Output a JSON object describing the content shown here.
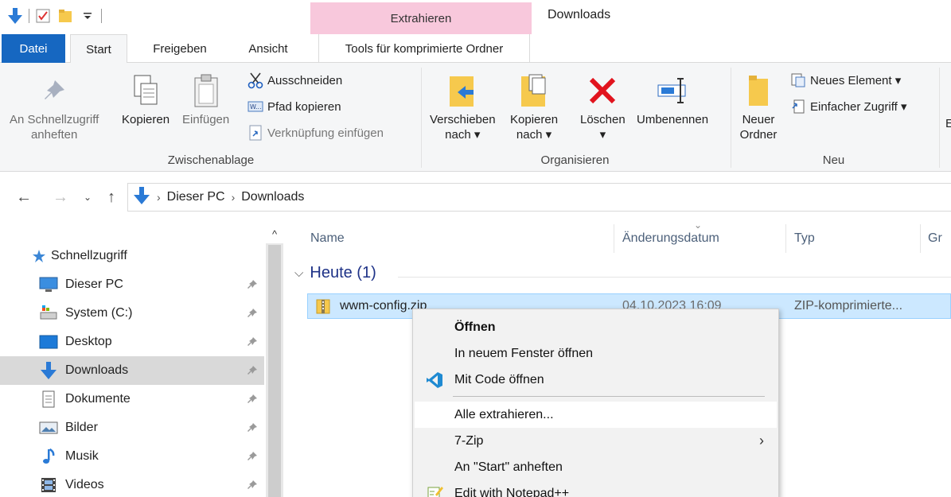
{
  "title_bar": {
    "contextual_tab_group": "Extrahieren",
    "window_title": "Downloads"
  },
  "ribbon_tabs": [
    "Datei",
    "Start",
    "Freigeben",
    "Ansicht",
    "Tools für komprimierte Ordner"
  ],
  "ribbon": {
    "pin_quick_access": [
      "An Schnellzugriff",
      "anheften"
    ],
    "copy": "Kopieren",
    "paste": "Einfügen",
    "cut": "Ausschneiden",
    "copy_path": "Pfad kopieren",
    "paste_shortcut": "Verknüpfung einfügen",
    "group_clipboard": "Zwischenablage",
    "move_to": [
      "Verschieben",
      "nach ▾"
    ],
    "copy_to": [
      "Kopieren",
      "nach ▾"
    ],
    "delete": [
      "Löschen",
      "▾"
    ],
    "rename": "Umbenennen",
    "group_organize": "Organisieren",
    "new_folder": [
      "Neuer",
      "Ordner"
    ],
    "new_item": "Neues Element ▾",
    "easy_access": "Einfacher Zugriff ▾",
    "group_new": "Neu",
    "truncated_right": "E"
  },
  "address": {
    "crumbs": [
      "Dieser PC",
      "Downloads"
    ]
  },
  "nav_pane": {
    "items": [
      {
        "label": "Schnellzugriff",
        "icon": "star-icon",
        "pinned": false
      },
      {
        "label": "Dieser PC",
        "icon": "monitor-icon",
        "pinned": true
      },
      {
        "label": "System (C:)",
        "icon": "drive-icon",
        "pinned": true
      },
      {
        "label": "Desktop",
        "icon": "desktop-icon",
        "pinned": true
      },
      {
        "label": "Downloads",
        "icon": "download-arrow-icon",
        "pinned": true,
        "selected": true
      },
      {
        "label": "Dokumente",
        "icon": "document-icon",
        "pinned": true
      },
      {
        "label": "Bilder",
        "icon": "pictures-icon",
        "pinned": true
      },
      {
        "label": "Musik",
        "icon": "music-note-icon",
        "pinned": true
      },
      {
        "label": "Videos",
        "icon": "film-icon",
        "pinned": true
      }
    ]
  },
  "file_list": {
    "columns": [
      "Name",
      "Änderungsdatum",
      "Typ",
      "Gr"
    ],
    "group_heading": "Heute (1)",
    "files": [
      {
        "name": "wwm-config.zip",
        "date": "04.10.2023 16:09",
        "type": "ZIP-komprimierte..."
      }
    ]
  },
  "context_menu": {
    "items": [
      {
        "label": "Öffnen",
        "bold": true
      },
      {
        "label": "In neuem Fenster öffnen"
      },
      {
        "label": "Mit Code öffnen",
        "icon": "vscode-icon"
      },
      {
        "label": "Alle extrahieren...",
        "hover": true
      },
      {
        "label": "7-Zip",
        "submenu": true
      },
      {
        "label": "An \"Start\" anheften"
      },
      {
        "label": "Edit with Notepad++",
        "icon": "notepadpp-icon"
      }
    ]
  },
  "colors": {
    "file_tab": "#1667c1",
    "contextual_tab": "#f8c8dc",
    "selection": "#cce8ff",
    "group_heading": "#1e3287"
  }
}
